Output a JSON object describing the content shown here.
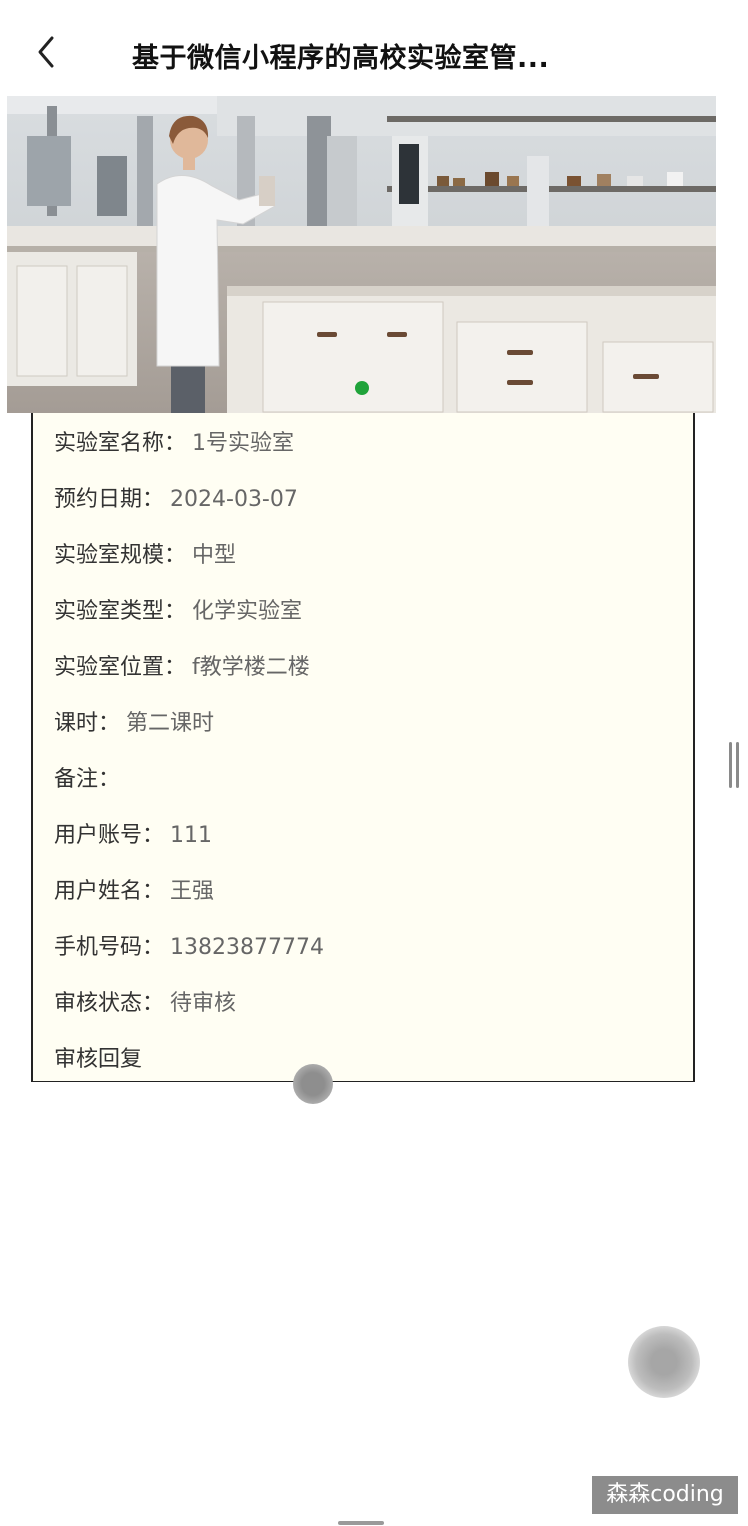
{
  "nav": {
    "title": "基于微信小程序的高校实验室管...",
    "back_icon": "chevron-left-icon"
  },
  "detail": {
    "rows": [
      {
        "label": "实验室名称：",
        "value": "1号实验室"
      },
      {
        "label": "预约日期：",
        "value": "2024-03-07"
      },
      {
        "label": "实验室规模：",
        "value": "中型"
      },
      {
        "label": "实验室类型：",
        "value": "化学实验室"
      },
      {
        "label": "实验室位置：",
        "value": "f教学楼二楼"
      },
      {
        "label": "课时：",
        "value": "第二课时"
      },
      {
        "label": "备注：",
        "value": ""
      },
      {
        "label": "用户账号：",
        "value": "111"
      },
      {
        "label": "用户姓名：",
        "value": "王强"
      },
      {
        "label": "手机号码：",
        "value": "13823877774"
      },
      {
        "label": "审核状态：",
        "value": "待审核"
      },
      {
        "label": "审核回复",
        "value": ""
      }
    ]
  },
  "watermark": "森森coding",
  "colors": {
    "card_background": "#fffef3",
    "label": "#333333",
    "value": "#666666"
  }
}
